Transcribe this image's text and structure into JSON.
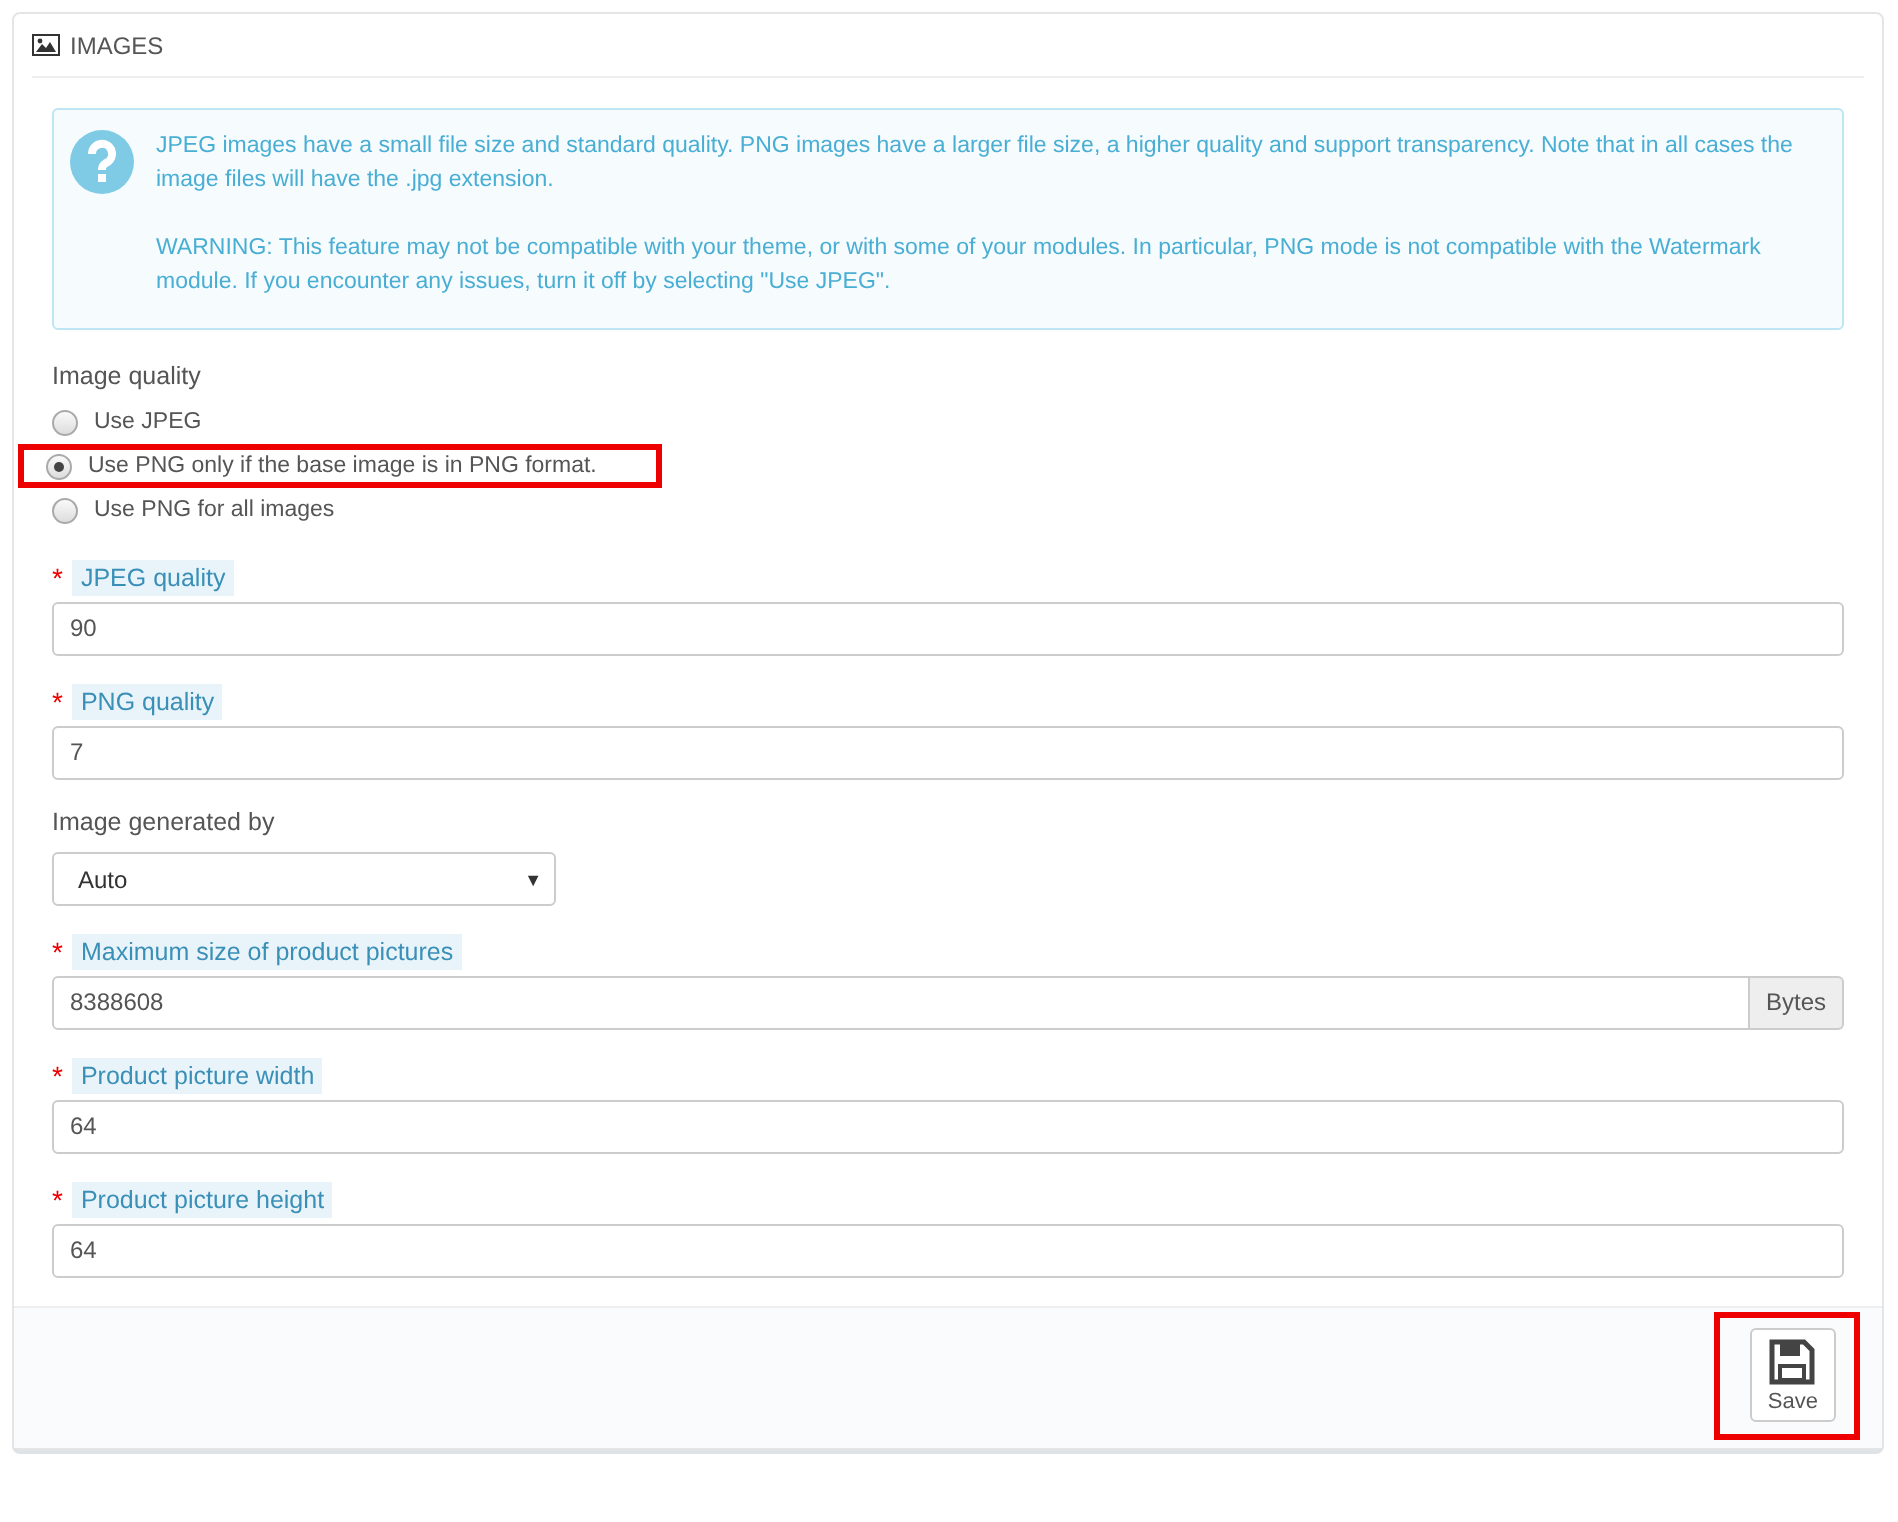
{
  "panel": {
    "title": "IMAGES"
  },
  "info": {
    "paragraphs": [
      "JPEG images have a small file size and standard quality. PNG images have a larger file size, a higher quality and support transparency. Note that in all cases the image files will have the .jpg extension.",
      "WARNING: This feature may not be compatible with your theme, or with some of your modules. In particular, PNG mode is not compatible with the Watermark module. If you encounter any issues, turn it off by selecting \"Use JPEG\"."
    ]
  },
  "image_quality": {
    "label": "Image quality",
    "options": [
      {
        "label": "Use JPEG",
        "selected": false,
        "highlighted": false
      },
      {
        "label": "Use PNG only if the base image is in PNG format.",
        "selected": true,
        "highlighted": true
      },
      {
        "label": "Use PNG for all images",
        "selected": false,
        "highlighted": false
      }
    ]
  },
  "fields": [
    {
      "kind": "text",
      "label": "JPEG quality",
      "required": true,
      "value": "90"
    },
    {
      "kind": "text",
      "label": "PNG quality",
      "required": true,
      "value": "7"
    },
    {
      "kind": "select",
      "label": "Image generated by",
      "required": false,
      "value": "Auto",
      "caret": "▼"
    },
    {
      "kind": "addon",
      "label": "Maximum size of product pictures",
      "required": true,
      "value": "8388608",
      "addon": "Bytes"
    },
    {
      "kind": "text",
      "label": "Product picture width",
      "required": true,
      "value": "64"
    },
    {
      "kind": "text",
      "label": "Product picture height",
      "required": true,
      "value": "64"
    }
  ],
  "required_mark": "*",
  "save": {
    "label": "Save",
    "highlighted": true
  }
}
